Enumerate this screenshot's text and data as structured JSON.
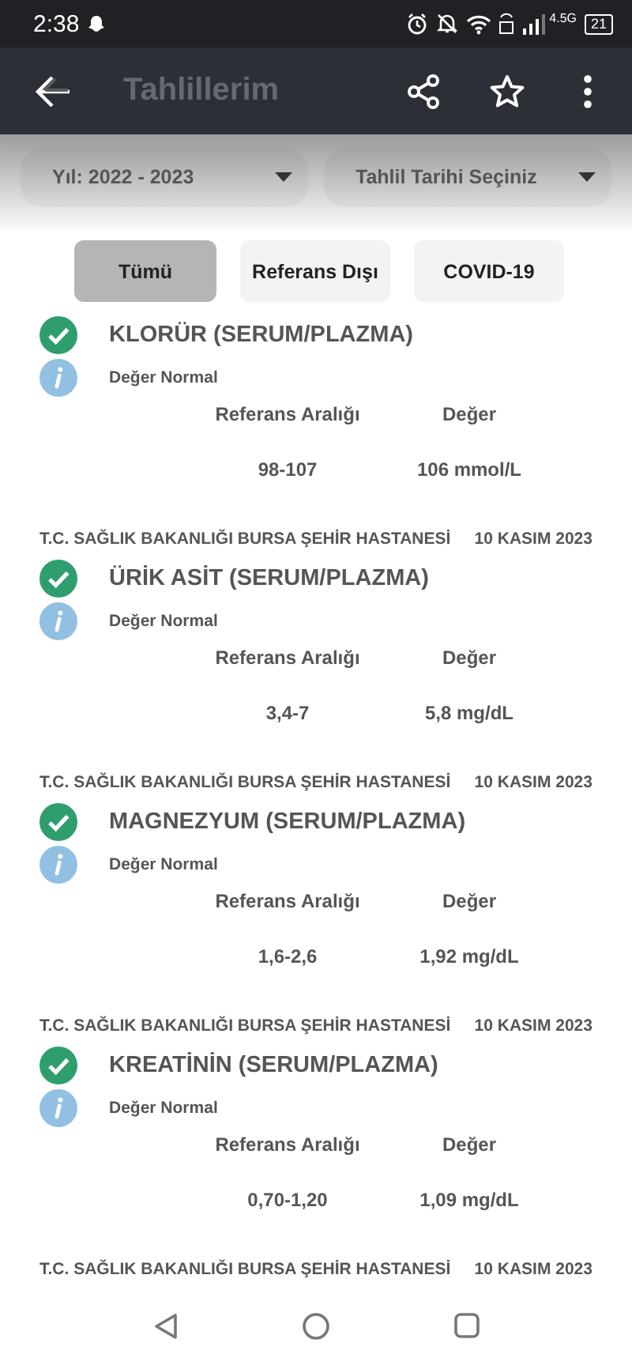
{
  "status_bar": {
    "time": "2:38",
    "network": "4.5G",
    "battery": "21"
  },
  "app_bar": {
    "title": "Tahlillerim"
  },
  "filters": {
    "year": "Yıl: 2022 - 2023",
    "date": "Tahlil Tarihi Seçiniz"
  },
  "tabs": [
    {
      "label": "Tümü",
      "selected": true
    },
    {
      "label": "Referans Dışı",
      "selected": false
    },
    {
      "label": "COVID-19",
      "selected": false
    }
  ],
  "results": [
    {
      "name": "KLORÜR (SERUM/PLAZMA)",
      "in_range": true,
      "note": "Değer Normal",
      "range_label": "Referans Aralığı",
      "value_label": "Değer",
      "range": "98-107",
      "value": "106 mmol/L"
    },
    {
      "hospital": "T.C. SAĞLIK BAKANLIĞI BURSA ŞEHİR HASTANESİ",
      "date": "10 KASIM 2023",
      "name": "ÜRİK ASİT (SERUM/PLAZMA)",
      "in_range": true,
      "note": "Değer Normal",
      "range_label": "Referans Aralığı",
      "value_label": "Değer",
      "range": "3,4-7",
      "value": "5,8 mg/dL"
    },
    {
      "hospital": "T.C. SAĞLIK BAKANLIĞI BURSA ŞEHİR HASTANESİ",
      "date": "10 KASIM 2023",
      "name": "MAGNEZYUM (SERUM/PLAZMA)",
      "in_range": true,
      "note": "Değer Normal",
      "range_label": "Referans Aralığı",
      "value_label": "Değer",
      "range": "1,6-2,6",
      "value": "1,92 mg/dL"
    },
    {
      "hospital": "T.C. SAĞLIK BAKANLIĞI BURSA ŞEHİR HASTANESİ",
      "date": "10 KASIM 2023",
      "name": "KREATİNİN (SERUM/PLAZMA)",
      "in_range": true,
      "note": "Değer Normal",
      "range_label": "Referans Aralığı",
      "value_label": "Değer",
      "range": "0,70-1,20",
      "value": "1,09 mg/dL"
    },
    {
      "hospital": "T.C. SAĞLIK BAKANLIĞI BURSA ŞEHİR HASTANESİ",
      "date": "10 KASIM 2023"
    }
  ]
}
